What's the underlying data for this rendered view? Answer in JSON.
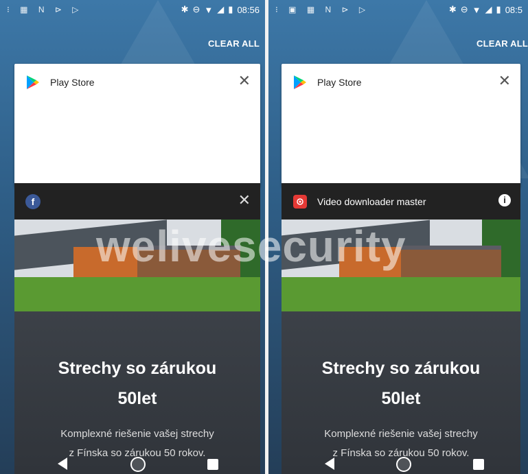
{
  "status_bar": {
    "left_time": "08:56",
    "right_time": "08:5"
  },
  "recents": {
    "clear_all_label": "CLEAR ALL"
  },
  "left_panel": {
    "top_card": {
      "app_name": "Play Store",
      "icon": "play-store-icon"
    },
    "bottom_card": {
      "app_name": "",
      "icon": "facebook-icon"
    }
  },
  "right_panel": {
    "top_card": {
      "app_name": "Play Store",
      "icon": "play-store-icon"
    },
    "bottom_card": {
      "app_name": "Video downloader master",
      "icon": "video-downloader-icon"
    }
  },
  "ad": {
    "headline_line1": "Strechy so zárukou",
    "headline_line2": "50let",
    "sub_line1": "Komplexné riešenie vašej strechy",
    "sub_line2": "z Fínska so zárukou 50 rokov."
  },
  "watermark": "welivesecurity",
  "colors": {
    "facebook": "#3b5998",
    "video_downloader": "#e53935",
    "play_green": "#00d474",
    "play_blue": "#00a0ff",
    "play_yellow": "#ffc107",
    "play_red": "#ff3a44"
  }
}
